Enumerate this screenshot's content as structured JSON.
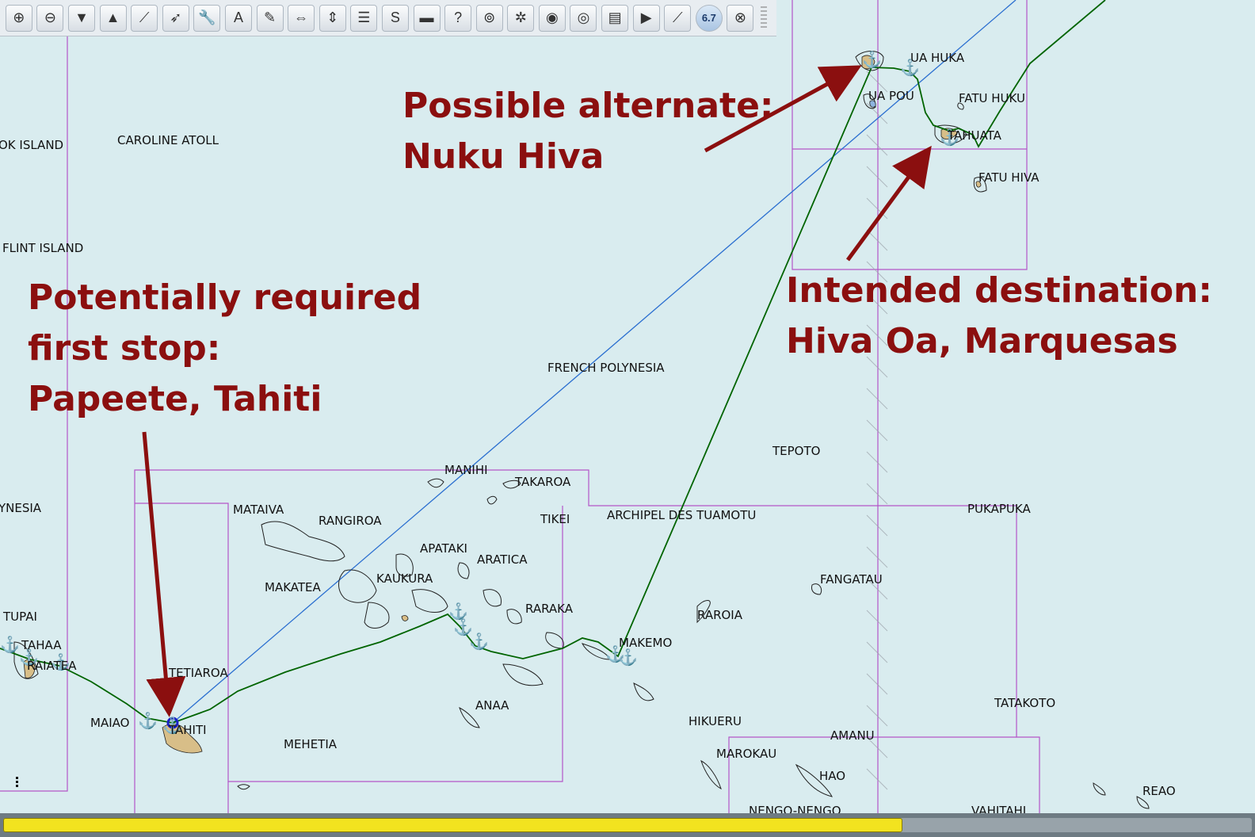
{
  "toolbar": {
    "buttons": [
      {
        "name": "zoom-in-icon",
        "glyph": "⊕"
      },
      {
        "name": "zoom-out-icon",
        "glyph": "⊖"
      },
      {
        "name": "scale-down-icon",
        "glyph": "▼"
      },
      {
        "name": "scale-up-icon",
        "glyph": "▲"
      },
      {
        "name": "route-icon",
        "glyph": "⟋"
      },
      {
        "name": "track-icon",
        "glyph": "➶"
      },
      {
        "name": "tools-icon",
        "glyph": "🔧"
      },
      {
        "name": "text-icon",
        "glyph": "A"
      },
      {
        "name": "edit-icon",
        "glyph": "✎"
      },
      {
        "name": "pan-horizontal-icon",
        "glyph": "⇔"
      },
      {
        "name": "pan-vertical-icon",
        "glyph": "⇕"
      },
      {
        "name": "route-manager-icon",
        "glyph": "☰"
      },
      {
        "name": "s-curve-icon",
        "glyph": "S"
      },
      {
        "name": "ship-icon",
        "glyph": "▬"
      },
      {
        "name": "help-icon",
        "glyph": "?"
      },
      {
        "name": "target-icon",
        "glyph": "⊚"
      },
      {
        "name": "sailing-icon",
        "glyph": "✲"
      },
      {
        "name": "layers-icon",
        "glyph": "◉"
      },
      {
        "name": "radar-icon",
        "glyph": "◎"
      },
      {
        "name": "chart-icon",
        "glyph": "▤"
      },
      {
        "name": "play-icon",
        "glyph": "▶"
      },
      {
        "name": "measure-icon",
        "glyph": "⟋"
      },
      {
        "name": "zoom-level-icon",
        "glyph": "6.7",
        "zoom": true
      },
      {
        "name": "lifebuoy-icon",
        "glyph": "⊗"
      }
    ]
  },
  "places": [
    {
      "name": "UA HUKA"
    },
    {
      "name": "UA POU"
    },
    {
      "name": "FATU HUKU"
    },
    {
      "name": "TAHUATA"
    },
    {
      "name": "FATU HIVA"
    },
    {
      "name": "CAROLINE ATOLL"
    },
    {
      "name": "OK ISLAND"
    },
    {
      "name": "FLINT ISLAND"
    },
    {
      "name": "FRENCH POLYNESIA"
    },
    {
      "name": "TEPOTO"
    },
    {
      "name": "YNESIA"
    },
    {
      "name": "MANIHI"
    },
    {
      "name": "TAKAROA"
    },
    {
      "name": "TIKEI"
    },
    {
      "name": "ARCHIPEL DES TUAMOTU"
    },
    {
      "name": "PUKAPUKA"
    },
    {
      "name": "MATAIVA"
    },
    {
      "name": "RANGIROA"
    },
    {
      "name": "APATAKI"
    },
    {
      "name": "ARATICA"
    },
    {
      "name": "KAUKURA"
    },
    {
      "name": "MAKATEA"
    },
    {
      "name": "FANGATAU"
    },
    {
      "name": "TUPAI"
    },
    {
      "name": "RARAKA"
    },
    {
      "name": "RAROIA"
    },
    {
      "name": "TAHAA"
    },
    {
      "name": "RAIATEA"
    },
    {
      "name": "MAKEMO"
    },
    {
      "name": "TETIAROA"
    },
    {
      "name": "ANAA"
    },
    {
      "name": "TATAKOTO"
    },
    {
      "name": "MAIAO"
    },
    {
      "name": "TAHITI"
    },
    {
      "name": "HIKUERU"
    },
    {
      "name": "AMANU"
    },
    {
      "name": "MEHETIA"
    },
    {
      "name": "MAROKAU"
    },
    {
      "name": "HAO"
    },
    {
      "name": "REAO"
    },
    {
      "name": "NENGO-NENGO"
    },
    {
      "name": "VAHITAHI"
    }
  ],
  "annotations": {
    "alternate": [
      "Possible alternate:",
      "Nuku Hiva"
    ],
    "destination": [
      "Intended destination:",
      "Hiva Oa, Marquesas"
    ],
    "first_stop": [
      "Potentially required",
      "first stop:",
      "Papeete, Tahiti"
    ]
  },
  "status": {
    "progress": 0.72
  },
  "colors": {
    "sea": "#d9ecef",
    "land": "#d8be88",
    "chart_boundary": "#b455c8",
    "route": "#006400",
    "great_circle": "#2b6fd0",
    "annotation": "#8b0f0f",
    "progress": "#f2e31f"
  }
}
